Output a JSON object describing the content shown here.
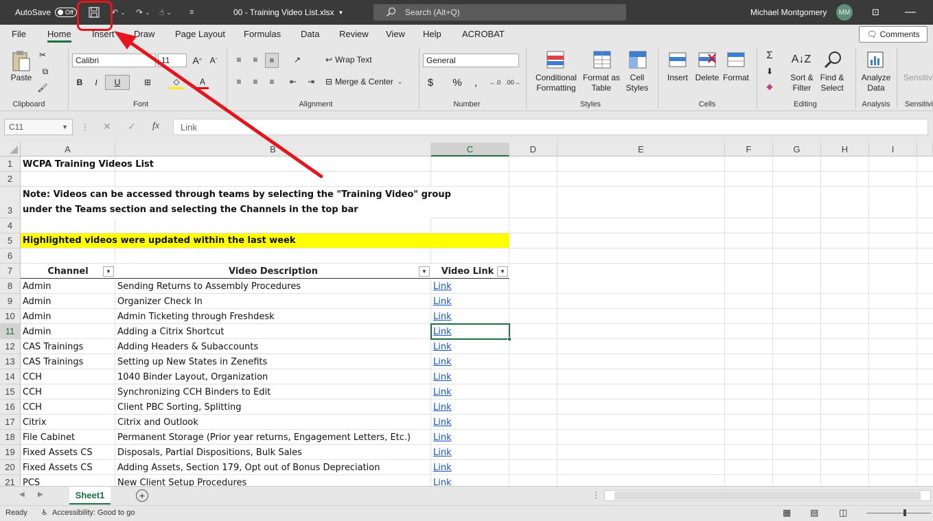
{
  "titlebar": {
    "autosave_label": "AutoSave",
    "autosave_state": "Off",
    "filename": "00 - Training Video List.xlsx",
    "search_placeholder": "Search (Alt+Q)",
    "user_name": "Michael Montgomery",
    "user_initials": "MM"
  },
  "menu": {
    "tabs": [
      "File",
      "Home",
      "Insert",
      "Draw",
      "Page Layout",
      "Formulas",
      "Data",
      "Review",
      "View",
      "Help",
      "ACROBAT"
    ],
    "active": "Home",
    "comments_label": "Comments"
  },
  "ribbon": {
    "clipboard": {
      "paste": "Paste",
      "group": "Clipboard"
    },
    "font": {
      "name": "Calibri",
      "size": "11",
      "group": "Font",
      "bold": "B",
      "italic": "I",
      "underline": "U"
    },
    "alignment": {
      "wrap": "Wrap Text",
      "merge": "Merge & Center",
      "group": "Alignment"
    },
    "number": {
      "format": "General",
      "group": "Number",
      "currency": "$",
      "percent": "%"
    },
    "styles": {
      "conditional_1": "Conditional",
      "conditional_2": "Formatting",
      "format_table_1": "Format as",
      "format_table_2": "Table",
      "cell_styles_1": "Cell",
      "cell_styles_2": "Styles",
      "group": "Styles"
    },
    "cells": {
      "insert": "Insert",
      "delete": "Delete",
      "format": "Format",
      "group": "Cells"
    },
    "editing": {
      "sort_1": "Sort &",
      "sort_2": "Filter",
      "find_1": "Find &",
      "find_2": "Select",
      "group": "Editing"
    },
    "analysis": {
      "analyze_1": "Analyze",
      "analyze_2": "Data",
      "group": "Analysis"
    },
    "sensitivity": {
      "label": "Sensitivi",
      "group": "Sensitivi"
    }
  },
  "formula_bar": {
    "name_box": "C11",
    "fx": "fx",
    "content": "Link"
  },
  "columns": [
    "A",
    "B",
    "C",
    "D",
    "E",
    "F",
    "G",
    "H",
    "I"
  ],
  "sheet": {
    "title": "WCPA Training Videos List",
    "note_line1": "Note: Videos can be accessed through teams by selecting the \"Training Video\" group",
    "note_line2": "under the Teams section and selecting the Channels in the top bar",
    "highlight_note": "Highlighted videos were updated within the last week",
    "headers": {
      "channel": "Channel",
      "description": "Video Description",
      "link": "Video Link"
    },
    "rows": [
      {
        "n": "8",
        "channel": "Admin",
        "desc": "Sending Returns to Assembly Procedures",
        "link": "Link"
      },
      {
        "n": "9",
        "channel": "Admin",
        "desc": "Organizer Check In",
        "link": "Link"
      },
      {
        "n": "10",
        "channel": "Admin",
        "desc": "Admin Ticketing through Freshdesk",
        "link": "Link"
      },
      {
        "n": "11",
        "channel": "Admin",
        "desc": "Adding a Citrix Shortcut",
        "link": "Link"
      },
      {
        "n": "12",
        "channel": "CAS Trainings",
        "desc": "Adding Headers & Subaccounts",
        "link": "Link"
      },
      {
        "n": "13",
        "channel": "CAS Trainings",
        "desc": "Setting up New States in Zenefits",
        "link": "Link"
      },
      {
        "n": "14",
        "channel": "CCH",
        "desc": "1040 Binder Layout, Organization",
        "link": "Link"
      },
      {
        "n": "15",
        "channel": "CCH",
        "desc": "Synchronizing CCH Binders to Edit",
        "link": "Link"
      },
      {
        "n": "16",
        "channel": "CCH",
        "desc": "Client PBC Sorting, Splitting",
        "link": "Link"
      },
      {
        "n": "17",
        "channel": "Citrix",
        "desc": "Citrix and Outlook",
        "link": "Link"
      },
      {
        "n": "18",
        "channel": "File Cabinet",
        "desc": "Permanent Storage (Prior year returns, Engagement Letters, Etc.)",
        "link": "Link"
      },
      {
        "n": "19",
        "channel": "Fixed Assets CS",
        "desc": "Disposals, Partial Dispositions, Bulk Sales",
        "link": "Link"
      },
      {
        "n": "20",
        "channel": "Fixed Assets CS",
        "desc": "Adding Assets, Section 179, Opt out of Bonus Depreciation",
        "link": "Link"
      },
      {
        "n": "21",
        "channel": "PCS",
        "desc": "New Client Setup Procedures",
        "link": "Link"
      }
    ]
  },
  "sheet_tab": "Sheet1",
  "status": {
    "ready": "Ready",
    "accessibility": "Accessibility: Good to go"
  },
  "colors": {
    "excel_green": "#1d6f42",
    "highlight": "#ffff00",
    "annotation_red": "#e8141c",
    "link_blue": "#1155cc"
  }
}
